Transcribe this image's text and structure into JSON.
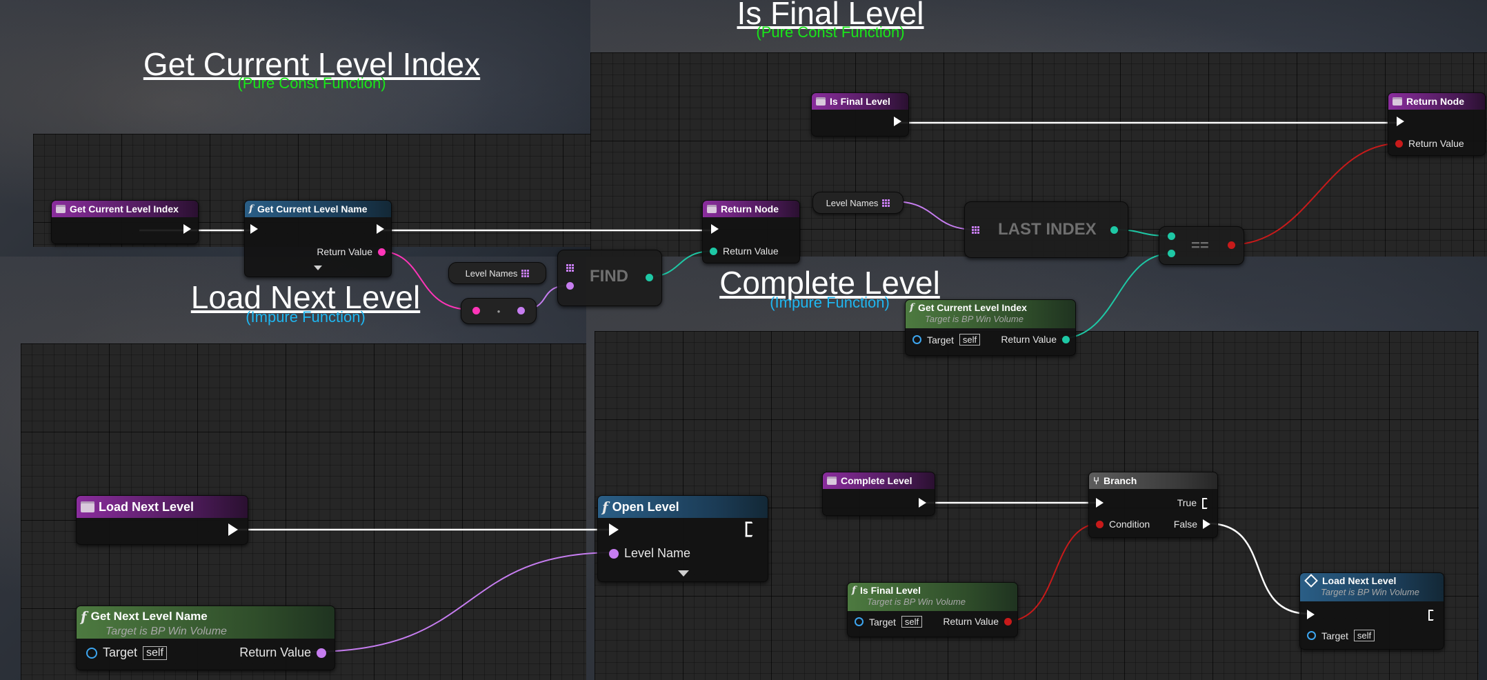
{
  "panels": {
    "get_current_level_index": {
      "title": "Get Current Level Index",
      "subtitle": "(Pure Const Function)"
    },
    "is_final_level": {
      "title": "Is Final Level",
      "subtitle": "(Pure Const Function)"
    },
    "load_next_level": {
      "title": "Load Next Level",
      "subtitle": "(Impure Function)"
    },
    "complete_level": {
      "title": "Complete Level",
      "subtitle": "(Impure Function)"
    }
  },
  "colors": {
    "title": "#ffffff",
    "pure_subtitle": "#19e619",
    "impure_subtitle": "#1fb6f0",
    "exec_wire": "#ffffff",
    "name_wire": "#c67df0",
    "string_wire": "#ff35b8",
    "int_wire": "#1ec8a5",
    "bool_wire": "#c81a1a"
  },
  "nodes": {
    "gcli_entry": {
      "title": "Get Current Level Index",
      "icon": "function-entry-icon"
    },
    "gcln": {
      "title": "Get Current Level Name",
      "return_label": "Return Value",
      "icon": "function-icon"
    },
    "gcli_return": {
      "title": "Return Node",
      "return_label": "Return Value"
    },
    "gcli_level_names": {
      "label": "Level Names"
    },
    "find": {
      "label": "FIND"
    },
    "conv": {
      "label": "•"
    },
    "ifl_entry": {
      "title": "Is Final Level"
    },
    "ifl_return": {
      "title": "Return Node",
      "return_label": "Return Value"
    },
    "ifl_level_names": {
      "label": "Level Names"
    },
    "last_index": {
      "label": "LAST INDEX"
    },
    "equals": {
      "label": "=="
    },
    "ifl_gcli": {
      "title": "Get Current Level Index",
      "subtitle": "Target is BP Win Volume",
      "target_label": "Target",
      "self_label": "self",
      "return_label": "Return Value"
    },
    "lnl_entry": {
      "title": "Load Next Level"
    },
    "open_level": {
      "title": "Open Level",
      "level_name_label": "Level Name"
    },
    "gnln": {
      "title": "Get Next Level Name",
      "subtitle": "Target is BP Win Volume",
      "target_label": "Target",
      "self_label": "self",
      "return_label": "Return Value"
    },
    "cl_entry": {
      "title": "Complete Level"
    },
    "branch": {
      "title": "Branch",
      "condition_label": "Condition",
      "true_label": "True",
      "false_label": "False"
    },
    "cl_ifl": {
      "title": "Is Final Level",
      "subtitle": "Target is BP Win Volume",
      "target_label": "Target",
      "self_label": "self",
      "return_label": "Return Value"
    },
    "cl_lnl": {
      "title": "Load Next Level",
      "subtitle": "Target is BP Win Volume",
      "target_label": "Target",
      "self_label": "self"
    }
  }
}
